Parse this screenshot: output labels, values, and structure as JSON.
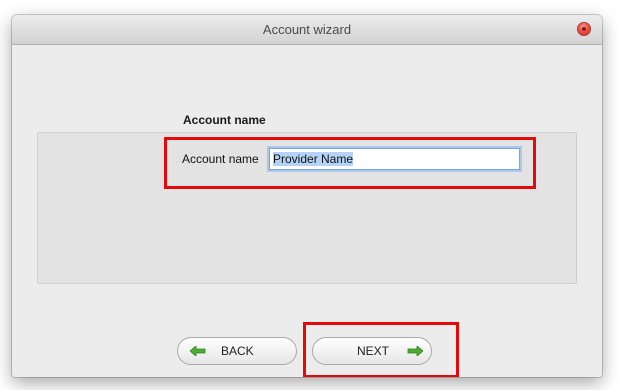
{
  "window": {
    "title": "Account wizard"
  },
  "section": {
    "title": "Account name"
  },
  "form": {
    "account_name_label": "Account name",
    "account_name_value": "Provider Name"
  },
  "buttons": {
    "back_label": "BACK",
    "next_label": "NEXT"
  },
  "icons": {
    "close": "close-icon",
    "back_arrow": "arrow-left-icon",
    "next_arrow": "arrow-right-icon"
  },
  "colors": {
    "annotation_red": "#e5090b",
    "arrow_green": "#4caf2f",
    "close_red": "#e94436"
  }
}
